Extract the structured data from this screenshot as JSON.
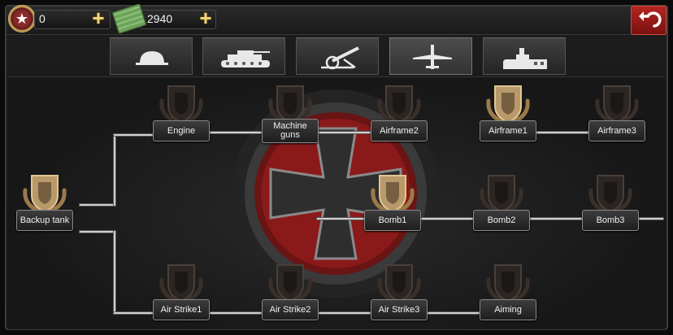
{
  "resources": {
    "stars": "0",
    "cash": "2940"
  },
  "icons": {
    "stars": "star-medal-icon",
    "cash": "cash-stack-icon",
    "add": "plus-icon",
    "back": "return-arrow-icon"
  },
  "tabs": [
    {
      "icon": "helmet-icon",
      "active": false
    },
    {
      "icon": "tank-icon",
      "active": false
    },
    {
      "icon": "artillery-icon",
      "active": false
    },
    {
      "icon": "aircraft-icon",
      "active": true
    },
    {
      "icon": "bunker-icon",
      "active": false
    }
  ],
  "tree": {
    "root": {
      "label": "Backup tank",
      "state": "unlocked"
    },
    "row1": [
      {
        "label": "Engine",
        "state": "locked"
      },
      {
        "label": "Machine guns",
        "state": "locked"
      },
      {
        "label": "Airframe2",
        "state": "locked"
      },
      {
        "label": "Airframe1",
        "state": "unlocked"
      },
      {
        "label": "Airframe3",
        "state": "locked"
      }
    ],
    "row2": [
      {
        "label": "Bomb1",
        "state": "unlocked"
      },
      {
        "label": "Bomb2",
        "state": "locked"
      },
      {
        "label": "Bomb3",
        "state": "locked"
      }
    ],
    "row3": [
      {
        "label": "Air Strike1",
        "state": "locked"
      },
      {
        "label": "Air Strike2",
        "state": "locked"
      },
      {
        "label": "Air Strike3",
        "state": "locked"
      },
      {
        "label": "Aiming",
        "state": "locked"
      }
    ]
  },
  "colors": {
    "accent_red": "#b42420",
    "gold": "#c9a35a",
    "background": "#171717"
  }
}
